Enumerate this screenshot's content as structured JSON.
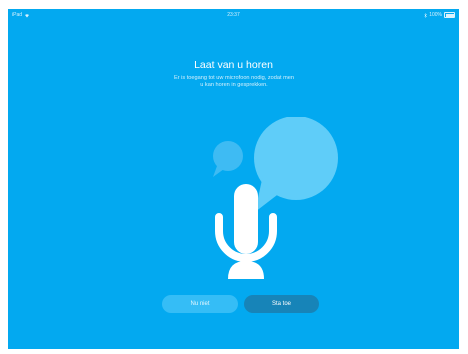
{
  "status_bar": {
    "device": "iPad",
    "time": "23:37",
    "battery": "100%"
  },
  "permission": {
    "title": "Laat van u horen",
    "description": "Er is toegang tot uw microfoon nodig, zodat men u kan horen in gesprekken."
  },
  "buttons": {
    "not_now": "Nu niet",
    "allow": "Sta toe"
  },
  "icons": {
    "wifi": "wifi-icon",
    "bluetooth": "bluetooth-icon",
    "battery": "battery-icon",
    "microphone": "microphone-icon",
    "speech_bubbles": "speech-bubble-icon"
  },
  "colors": {
    "background": "#03a9f0",
    "button_secondary": "#35bdf6",
    "button_primary": "#1784b8",
    "bubble_large": "#5fcdf9",
    "bubble_small": "#3ebbf3"
  }
}
